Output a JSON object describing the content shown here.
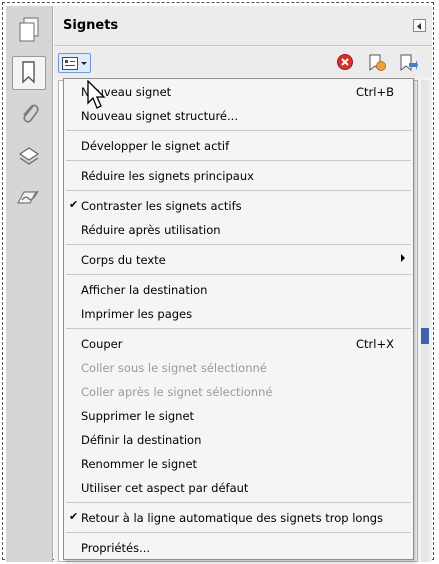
{
  "panel": {
    "title": "Signets"
  },
  "rail": {
    "items": [
      {
        "name": "pages",
        "icon": "page-thumbnails-icon"
      },
      {
        "name": "bookmarks",
        "icon": "bookmark-icon",
        "active": true
      },
      {
        "name": "attachments",
        "icon": "paperclip-icon"
      },
      {
        "name": "layers",
        "icon": "layers-icon"
      },
      {
        "name": "signatures",
        "icon": "signature-icon"
      }
    ]
  },
  "toolbar": {
    "options_icon": "options-menu-icon",
    "delete_icon": "delete-bookmark-icon",
    "new_bookmark_icon": "new-bookmark-icon",
    "expand_icon": "expand-bookmark-icon"
  },
  "menu": {
    "items": [
      {
        "label": "Nouveau signet",
        "shortcut": "Ctrl+B"
      },
      {
        "label": "Nouveau signet structuré..."
      },
      {
        "label": "Développer le signet actif"
      },
      {
        "label": "Réduire les signets principaux"
      },
      {
        "label": "Contraster les signets actifs",
        "checked": true
      },
      {
        "label": "Réduire après utilisation"
      },
      {
        "label": "Corps du texte",
        "submenu": true
      },
      {
        "label": "Afficher la destination"
      },
      {
        "label": "Imprimer les pages"
      },
      {
        "label": "Couper",
        "shortcut": "Ctrl+X"
      },
      {
        "label": "Coller sous le signet sélectionné",
        "disabled": true
      },
      {
        "label": "Coller après le signet sélectionné",
        "disabled": true
      },
      {
        "label": "Supprimer le signet"
      },
      {
        "label": "Définir la destination"
      },
      {
        "label": "Renommer le signet"
      },
      {
        "label": "Utiliser cet aspect par défaut"
      },
      {
        "label": "Retour à la ligne automatique des signets trop longs",
        "checked": true
      },
      {
        "label": "Propriétés..."
      }
    ]
  },
  "colors": {
    "accent": "#3b63b0",
    "delete_red": "#d9302c",
    "folder_orange": "#e8a33a"
  }
}
